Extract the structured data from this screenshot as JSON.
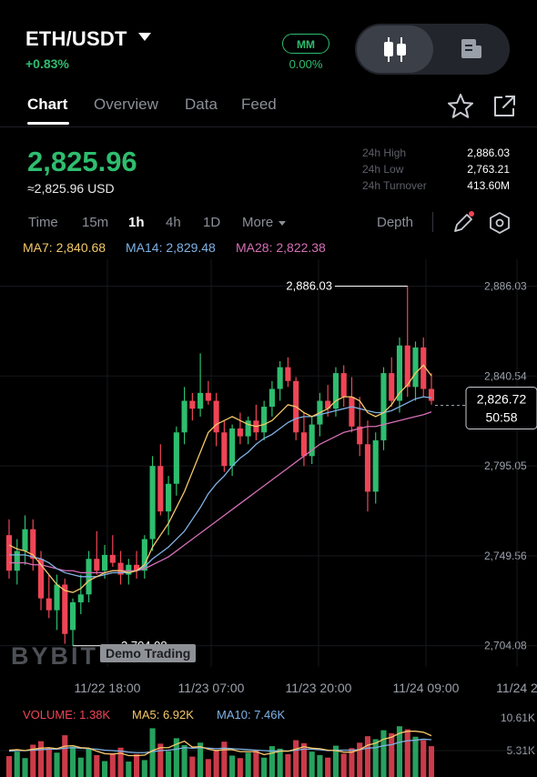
{
  "header": {
    "pair": "ETH/USDT",
    "change_pct": "+0.83%",
    "mm_label": "MM",
    "mm_pct": "0.00%"
  },
  "tabs": [
    {
      "label": "Chart",
      "active": true
    },
    {
      "label": "Overview"
    },
    {
      "label": "Data"
    },
    {
      "label": "Feed"
    }
  ],
  "icons": {
    "favorite": "star-icon",
    "share": "share-icon",
    "candle_toggle": "candlestick-icon",
    "book_toggle": "orderbook-icon",
    "draw": "pencil-icon",
    "settings": "hexagon-settings-icon"
  },
  "price": {
    "last": "2,825.96",
    "usd": "≈2,825.96 USD"
  },
  "stats": [
    {
      "label": "24h High",
      "value": "2,886.03"
    },
    {
      "label": "24h Low",
      "value": "2,763.21"
    },
    {
      "label": "24h Turnover",
      "value": "413.60M"
    }
  ],
  "timeframes": {
    "items": [
      "Time",
      "15m",
      "1h",
      "4h",
      "1D",
      "More"
    ],
    "active": "1h",
    "depth": "Depth"
  },
  "ma": {
    "ma7": "MA7: 2,840.68",
    "ma14": "MA14: 2,829.48",
    "ma28": "MA28: 2,822.38"
  },
  "watermark": {
    "logo": "BYBIT",
    "demo": "Demo Trading"
  },
  "volume_legend": {
    "vol": "VOLUME: 1.38K",
    "ma5": "MA5: 6.92K",
    "ma10": "MA10: 7.46K"
  },
  "volume_axis": [
    "10.61K",
    "5.31K"
  ],
  "current_price_tag": {
    "price": "2,826.72",
    "countdown": "50:58"
  },
  "colors": {
    "up": "#2ebd6f",
    "down": "#ef4556",
    "ma7": "#f5c86a",
    "ma14": "#7fb2e6",
    "ma28": "#d56fb5"
  },
  "chart_data": {
    "type": "candlestick",
    "ylabels": [
      "2,886.03",
      "2,840.54",
      "2,795.05",
      "2,749.56",
      "2,704.08"
    ],
    "yvalues": [
      2886.03,
      2840.54,
      2795.05,
      2749.56,
      2704.08
    ],
    "ylim": [
      2697,
      2895
    ],
    "xlabels": [
      "11/22 18:00",
      "11/23 07:00",
      "11/23 20:00",
      "11/24 09:00",
      "11/24 2"
    ],
    "annotations": {
      "high": "2,886.03",
      "low": "2,704.08"
    },
    "candles": [
      [
        2760,
        2768,
        2738,
        2742
      ],
      [
        2742,
        2758,
        2735,
        2752
      ],
      [
        2752,
        2770,
        2745,
        2763
      ],
      [
        2763,
        2768,
        2742,
        2748
      ],
      [
        2748,
        2752,
        2722,
        2728
      ],
      [
        2728,
        2740,
        2718,
        2722
      ],
      [
        2722,
        2740,
        2712,
        2735
      ],
      [
        2735,
        2738,
        2705,
        2710
      ],
      [
        2712,
        2728,
        2704,
        2726
      ],
      [
        2726,
        2740,
        2720,
        2730
      ],
      [
        2730,
        2752,
        2726,
        2748
      ],
      [
        2748,
        2762,
        2740,
        2742
      ],
      [
        2742,
        2755,
        2738,
        2750
      ],
      [
        2750,
        2760,
        2744,
        2746
      ],
      [
        2746,
        2752,
        2735,
        2740
      ],
      [
        2740,
        2748,
        2735,
        2745
      ],
      [
        2745,
        2752,
        2738,
        2742
      ],
      [
        2742,
        2760,
        2738,
        2758
      ],
      [
        2758,
        2800,
        2752,
        2795
      ],
      [
        2795,
        2806,
        2770,
        2772
      ],
      [
        2772,
        2790,
        2760,
        2786
      ],
      [
        2786,
        2815,
        2780,
        2812
      ],
      [
        2812,
        2835,
        2806,
        2828
      ],
      [
        2828,
        2832,
        2818,
        2824
      ],
      [
        2824,
        2852,
        2820,
        2832
      ],
      [
        2832,
        2838,
        2826,
        2828
      ],
      [
        2828,
        2832,
        2805,
        2812
      ],
      [
        2812,
        2818,
        2792,
        2795
      ],
      [
        2795,
        2816,
        2790,
        2814
      ],
      [
        2814,
        2822,
        2806,
        2810
      ],
      [
        2810,
        2820,
        2806,
        2818
      ],
      [
        2818,
        2826,
        2808,
        2812
      ],
      [
        2812,
        2828,
        2808,
        2825
      ],
      [
        2825,
        2838,
        2820,
        2834
      ],
      [
        2834,
        2848,
        2828,
        2845
      ],
      [
        2845,
        2850,
        2835,
        2838
      ],
      [
        2838,
        2840,
        2808,
        2812
      ],
      [
        2812,
        2822,
        2795,
        2800
      ],
      [
        2800,
        2820,
        2796,
        2816
      ],
      [
        2816,
        2832,
        2810,
        2828
      ],
      [
        2828,
        2836,
        2820,
        2824
      ],
      [
        2824,
        2845,
        2820,
        2842
      ],
      [
        2842,
        2846,
        2825,
        2830
      ],
      [
        2830,
        2840,
        2812,
        2815
      ],
      [
        2815,
        2830,
        2800,
        2806
      ],
      [
        2806,
        2818,
        2772,
        2782
      ],
      [
        2782,
        2812,
        2776,
        2808
      ],
      [
        2808,
        2845,
        2803,
        2842
      ],
      [
        2842,
        2850,
        2825,
        2828
      ],
      [
        2828,
        2860,
        2822,
        2856
      ],
      [
        2856,
        2886,
        2830,
        2835
      ],
      [
        2835,
        2858,
        2828,
        2855
      ],
      [
        2855,
        2860,
        2830,
        2834
      ],
      [
        2834,
        2842,
        2826,
        2828
      ]
    ],
    "ma7": [
      2755,
      2753,
      2752,
      2750,
      2745,
      2740,
      2735,
      2732,
      2731,
      2733,
      2737,
      2739,
      2741,
      2742,
      2742,
      2741,
      2742,
      2745,
      2754,
      2760,
      2766,
      2774,
      2782,
      2792,
      2802,
      2812,
      2816,
      2818,
      2820,
      2818,
      2816,
      2815,
      2816,
      2818,
      2822,
      2826,
      2825,
      2822,
      2820,
      2822,
      2824,
      2828,
      2830,
      2830,
      2828,
      2822,
      2820,
      2822,
      2826,
      2832,
      2836,
      2842,
      2846,
      2840.68
    ],
    "ma14": [
      2750,
      2750,
      2750,
      2749,
      2748,
      2746,
      2743,
      2741,
      2740,
      2739,
      2739,
      2739,
      2740,
      2741,
      2741,
      2741,
      2742,
      2744,
      2748,
      2751,
      2754,
      2758,
      2762,
      2768,
      2774,
      2781,
      2786,
      2790,
      2795,
      2799,
      2802,
      2806,
      2809,
      2811,
      2814,
      2817,
      2819,
      2820,
      2820,
      2821,
      2822,
      2823,
      2824,
      2825,
      2824,
      2823,
      2822,
      2822,
      2823,
      2825,
      2827,
      2829,
      2830,
      2829.48
    ],
    "ma28": [
      2746,
      2746,
      2746,
      2745,
      2745,
      2744,
      2743,
      2742,
      2742,
      2741,
      2741,
      2741,
      2741,
      2742,
      2742,
      2742,
      2742,
      2743,
      2745,
      2747,
      2749,
      2752,
      2755,
      2758,
      2761,
      2764,
      2767,
      2770,
      2773,
      2776,
      2779,
      2782,
      2785,
      2788,
      2791,
      2794,
      2797,
      2800,
      2803,
      2806,
      2808,
      2810,
      2812,
      2813,
      2814,
      2815,
      2815,
      2816,
      2817,
      2818,
      2819,
      2820,
      2821,
      2822.38
    ],
    "volume": [
      4.2,
      5.1,
      3.8,
      6.5,
      7.2,
      5.8,
      4.9,
      8.4,
      6.1,
      3.9,
      5.6,
      4.4,
      3.2,
      4.8,
      5.9,
      3.1,
      4.6,
      3.4,
      9.8,
      6.7,
      5.2,
      7.8,
      6.4,
      4.1,
      6.9,
      3.6,
      5.5,
      7.1,
      4.3,
      3.8,
      4.9,
      5.4,
      3.9,
      6.2,
      5.7,
      4.6,
      7.4,
      6.8,
      5.1,
      4.4,
      3.9,
      6.3,
      4.7,
      5.8,
      6.9,
      8.2,
      7.6,
      9.4,
      8.8,
      10.2,
      9.6,
      8.1,
      7.4,
      6.2
    ],
    "vol_ma5": [
      5.4,
      5.5,
      5.3,
      5.6,
      5.8,
      5.9,
      5.7,
      6.2,
      6.3,
      5.9,
      5.8,
      5.2,
      4.7,
      4.6,
      4.8,
      4.3,
      4.3,
      4.4,
      5.3,
      5.9,
      5.9,
      6.6,
      7.2,
      6.0,
      6.1,
      5.6,
      5.3,
      5.5,
      5.5,
      5.1,
      5.1,
      5.1,
      4.5,
      4.8,
      5.2,
      5.2,
      5.6,
      6.1,
      5.8,
      5.7,
      5.4,
      5.3,
      5.0,
      5.0,
      5.5,
      6.4,
      6.8,
      7.6,
      8.0,
      8.8,
      9.2,
      9.2,
      9.0,
      8.3
    ],
    "vol_ma10": [
      5.2,
      5.3,
      5.3,
      5.4,
      5.5,
      5.6,
      5.6,
      5.8,
      5.9,
      5.8,
      5.7,
      5.6,
      5.4,
      5.3,
      5.2,
      5.0,
      4.9,
      4.9,
      5.1,
      5.3,
      5.4,
      5.6,
      5.9,
      5.8,
      5.9,
      5.8,
      5.7,
      5.8,
      5.7,
      5.6,
      5.5,
      5.4,
      5.3,
      5.2,
      5.3,
      5.2,
      5.4,
      5.6,
      5.6,
      5.5,
      5.3,
      5.4,
      5.4,
      5.4,
      5.5,
      5.8,
      5.9,
      6.3,
      6.5,
      7.0,
      7.3,
      7.4,
      7.6,
      7.5
    ]
  }
}
